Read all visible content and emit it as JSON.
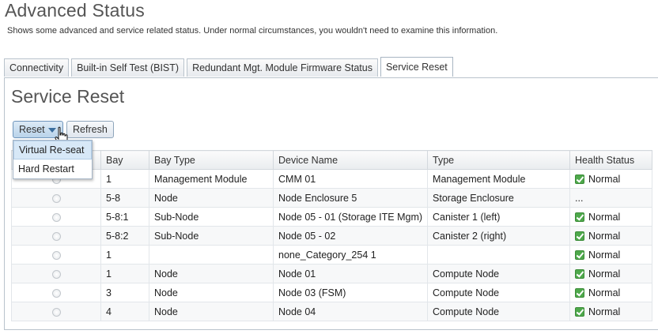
{
  "page": {
    "title": "Advanced Status",
    "description": "Shows some advanced and service related status. Under normal circumstances, you wouldn't need to examine this information."
  },
  "tabs": [
    {
      "label": "Connectivity"
    },
    {
      "label": "Built-in Self Test (BIST)"
    },
    {
      "label": "Redundant Mgt. Module Firmware Status"
    },
    {
      "label": "Service Reset"
    }
  ],
  "section": {
    "title": "Service Reset"
  },
  "toolbar": {
    "reset_label": "Reset",
    "refresh_label": "Refresh"
  },
  "reset_menu": [
    {
      "label": "Virtual Re-seat"
    },
    {
      "label": "Hard Restart"
    }
  ],
  "table": {
    "columns": [
      "",
      "Bay",
      "Bay Type",
      "Device Name",
      "Type",
      "Health Status"
    ],
    "rows": [
      {
        "bay": "1",
        "bay_type": "Management Module",
        "device": "CMM 01",
        "type": "Management Module",
        "health": "Normal",
        "health_icon": "check-icon"
      },
      {
        "bay": "5-8",
        "bay_type": "Node",
        "device": "Node Enclosure 5",
        "type": "Storage Enclosure",
        "health": "...",
        "health_icon": ""
      },
      {
        "bay": "5-8:1",
        "bay_type": "Sub-Node",
        "device": "Node 05 - 01 (Storage ITE Mgm)",
        "type": "Canister 1 (left)",
        "health": "Normal",
        "health_icon": "check-icon"
      },
      {
        "bay": "5-8:2",
        "bay_type": "Sub-Node",
        "device": "Node 05 - 02",
        "type": "Canister 2 (right)",
        "health": "Normal",
        "health_icon": "check-icon"
      },
      {
        "bay": "1",
        "bay_type": "",
        "device": "none_Category_254 1",
        "type": "",
        "health": "Normal",
        "health_icon": "check-icon"
      },
      {
        "bay": "1",
        "bay_type": "Node",
        "device": "Node 01",
        "type": "Compute Node",
        "health": "Normal",
        "health_icon": "check-icon"
      },
      {
        "bay": "3",
        "bay_type": "Node",
        "device": "Node 03 (FSM)",
        "type": "Compute Node",
        "health": "Normal",
        "health_icon": "check-icon"
      },
      {
        "bay": "4",
        "bay_type": "Node",
        "device": "Node 04",
        "type": "Compute Node",
        "health": "Normal",
        "health_icon": "check-icon"
      }
    ]
  },
  "colors": {
    "healthy": "#4ea84b",
    "accent": "#3b6e9e"
  }
}
